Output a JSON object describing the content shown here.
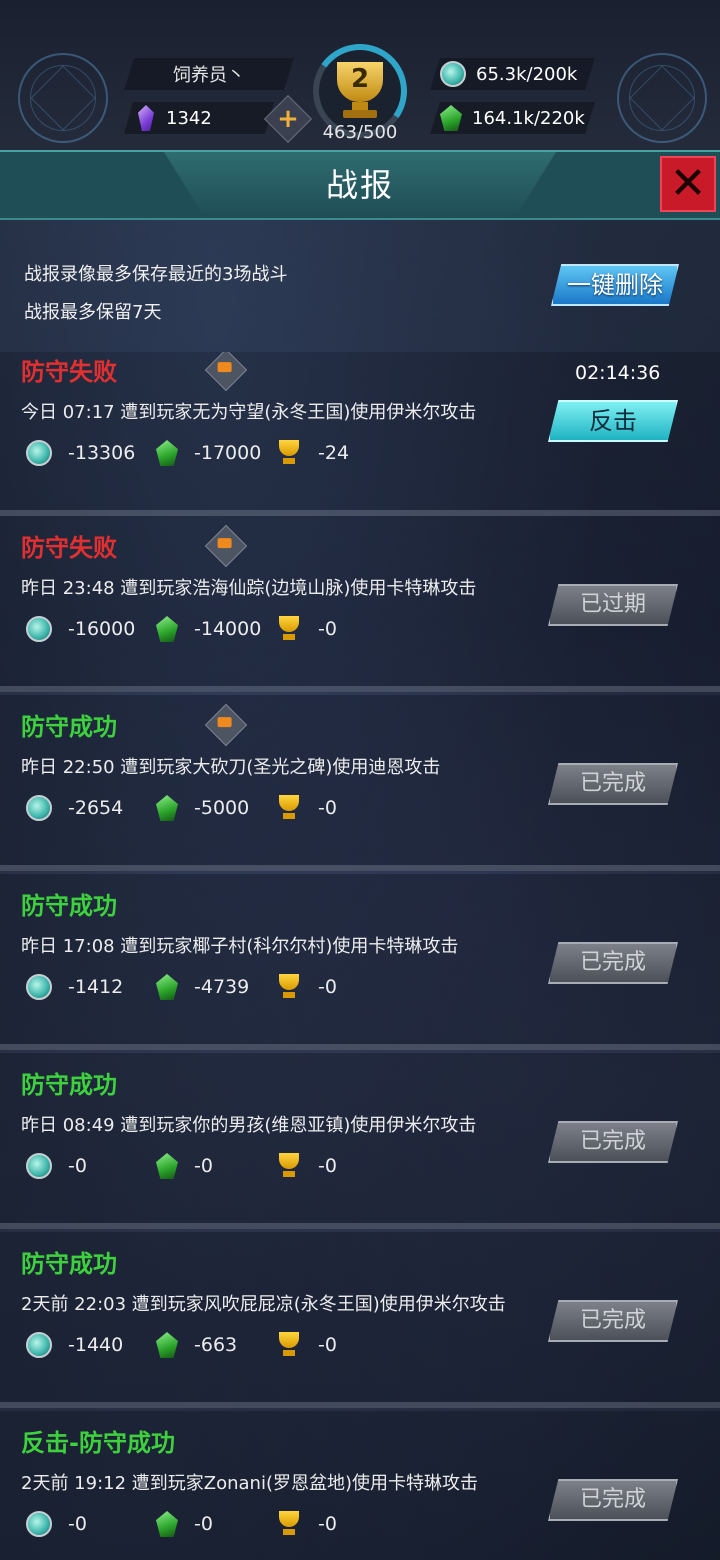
{
  "hud": {
    "player_name": "饲养员丶",
    "gems": "1342",
    "trophy_level": "2",
    "trophy_progress": "463/500",
    "resource_coin": "65.3k/200k",
    "resource_leaf": "164.1k/220k"
  },
  "title": "战报",
  "info": {
    "line1": "战报录像最多保存最近的3场战斗",
    "line2": "战报最多保留7天",
    "delete_all_label": "一键删除"
  },
  "reports": [
    {
      "status": "防守失败",
      "status_type": "fail",
      "has_replay": true,
      "desc": "今日 07:17 遭到玩家无为守望(永冬王国)使用伊米尔攻击",
      "coin": "-13306",
      "leaf": "-17000",
      "trophy": "-24",
      "timer": "02:14:36",
      "action": "反击",
      "action_type": "counter"
    },
    {
      "status": "防守失败",
      "status_type": "fail",
      "has_replay": true,
      "desc": "昨日 23:48 遭到玩家浩海仙踪(边境山脉)使用卡特琳攻击",
      "coin": "-16000",
      "leaf": "-14000",
      "trophy": "-0",
      "action": "已过期",
      "action_type": "disabled"
    },
    {
      "status": "防守成功",
      "status_type": "ok",
      "has_replay": true,
      "desc": "昨日 22:50 遭到玩家大砍刀(圣光之碑)使用迪恩攻击",
      "coin": "-2654",
      "leaf": "-5000",
      "trophy": "-0",
      "action": "已完成",
      "action_type": "disabled"
    },
    {
      "status": "防守成功",
      "status_type": "ok",
      "has_replay": false,
      "desc": "昨日 17:08 遭到玩家椰子村(科尔尔村)使用卡特琳攻击",
      "coin": "-1412",
      "leaf": "-4739",
      "trophy": "-0",
      "action": "已完成",
      "action_type": "disabled"
    },
    {
      "status": "防守成功",
      "status_type": "ok",
      "has_replay": false,
      "desc": "昨日 08:49 遭到玩家你的男孩(维恩亚镇)使用伊米尔攻击",
      "coin": "-0",
      "leaf": "-0",
      "trophy": "-0",
      "action": "已完成",
      "action_type": "disabled"
    },
    {
      "status": "防守成功",
      "status_type": "ok",
      "has_replay": false,
      "desc": "2天前 22:03 遭到玩家风吹屁屁凉(永冬王国)使用伊米尔攻击",
      "coin": "-1440",
      "leaf": "-663",
      "trophy": "-0",
      "action": "已完成",
      "action_type": "disabled"
    },
    {
      "status": "反击-防守成功",
      "status_type": "ok",
      "has_replay": false,
      "desc": "2天前 19:12 遭到玩家Zonani(罗恩盆地)使用卡特琳攻击",
      "coin": "-0",
      "leaf": "-0",
      "trophy": "-0",
      "action": "已完成",
      "action_type": "disabled"
    }
  ],
  "colors": {
    "fail": "#e23030",
    "ok": "#3ed13e",
    "counter_button": "#1fb3c2",
    "title_bar": "#2f6c70",
    "close_button": "#c91a2a"
  },
  "icons": {
    "coin": "coin-icon",
    "leaf": "leaf-icon",
    "trophy": "trophy-icon",
    "replay": "video-camera-icon",
    "close": "close-icon"
  }
}
